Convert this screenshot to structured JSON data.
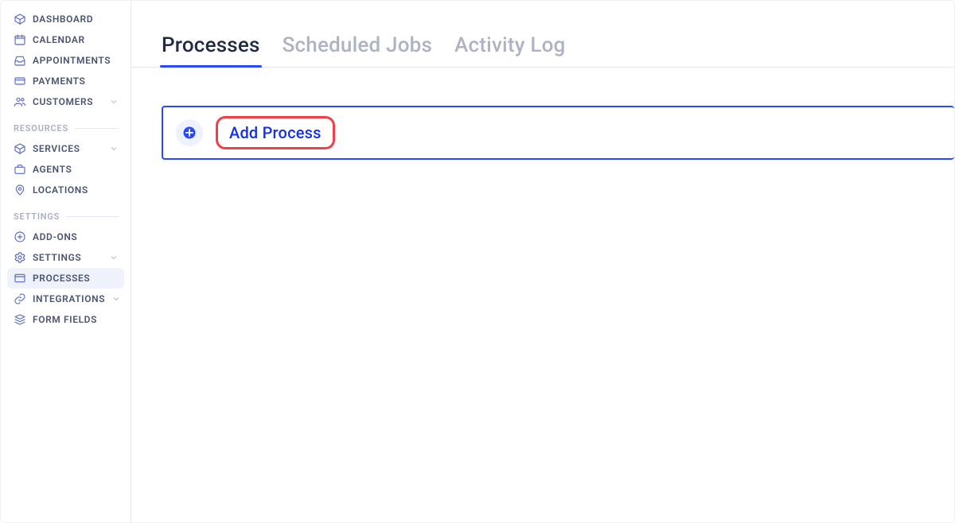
{
  "sidebar": {
    "primary": [
      {
        "label": "DASHBOARD",
        "icon": "cube-icon",
        "expandable": false
      },
      {
        "label": "CALENDAR",
        "icon": "calendar-icon",
        "expandable": false
      },
      {
        "label": "APPOINTMENTS",
        "icon": "inbox-icon",
        "expandable": false
      },
      {
        "label": "PAYMENTS",
        "icon": "card-icon",
        "expandable": false
      },
      {
        "label": "CUSTOMERS",
        "icon": "users-icon",
        "expandable": true
      }
    ],
    "sections": [
      {
        "title": "RESOURCES",
        "items": [
          {
            "label": "SERVICES",
            "icon": "package-icon",
            "expandable": true
          },
          {
            "label": "AGENTS",
            "icon": "briefcase-icon",
            "expandable": false
          },
          {
            "label": "LOCATIONS",
            "icon": "pin-icon",
            "expandable": false
          }
        ]
      },
      {
        "title": "SETTINGS",
        "items": [
          {
            "label": "ADD-ONS",
            "icon": "plus-circle-icon",
            "expandable": false
          },
          {
            "label": "SETTINGS",
            "icon": "gear-icon",
            "expandable": true
          },
          {
            "label": "PROCESSES",
            "icon": "window-icon",
            "expandable": false,
            "active": true
          },
          {
            "label": "INTEGRATIONS",
            "icon": "link-icon",
            "expandable": true
          },
          {
            "label": "FORM FIELDS",
            "icon": "stack-icon",
            "expandable": false
          }
        ]
      }
    ]
  },
  "tabs": [
    {
      "label": "Processes",
      "active": true
    },
    {
      "label": "Scheduled Jobs",
      "active": false
    },
    {
      "label": "Activity Log",
      "active": false
    }
  ],
  "main": {
    "add_process_label": "Add Process"
  }
}
